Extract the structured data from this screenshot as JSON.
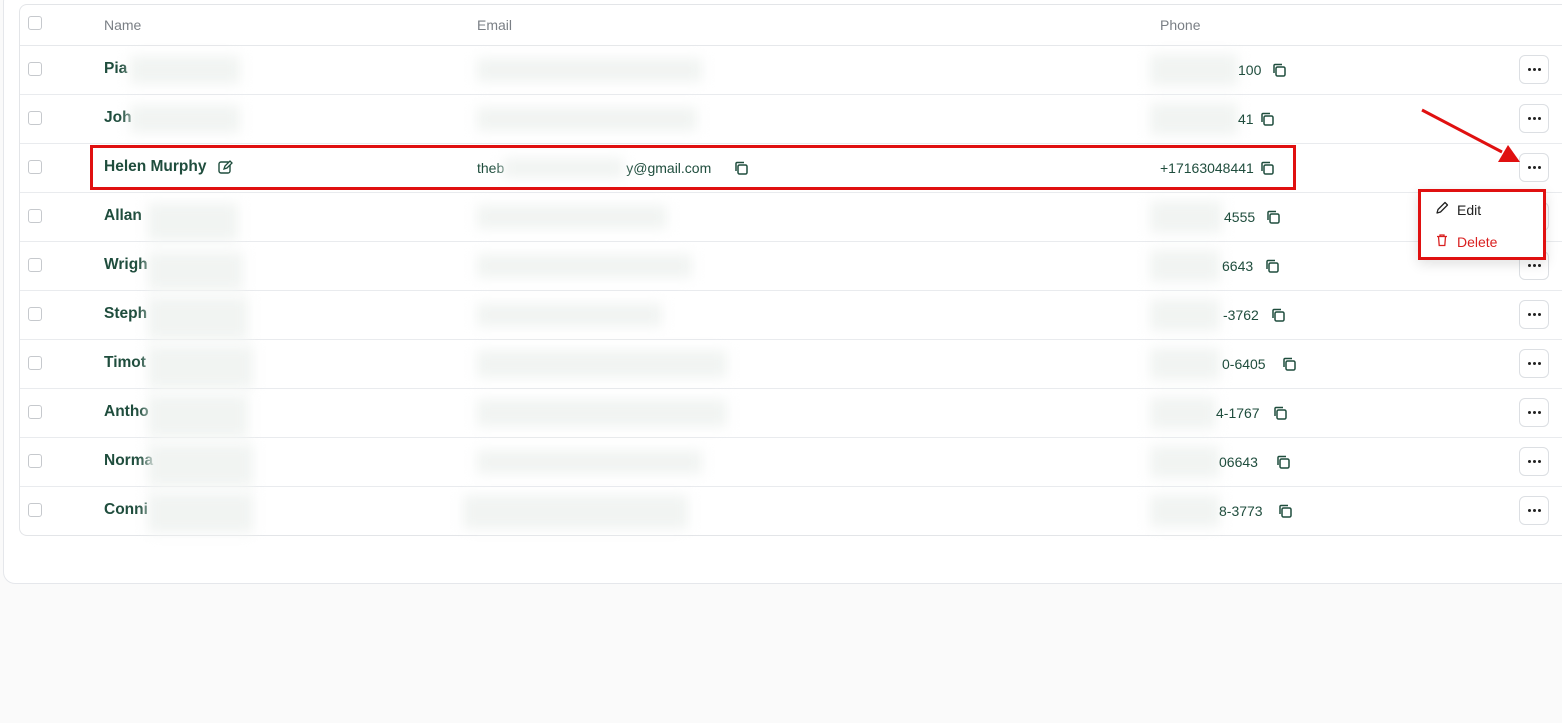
{
  "table": {
    "headers": {
      "name": "Name",
      "email": "Email",
      "phone": "Phone"
    },
    "rows": [
      {
        "name": "Pia",
        "email": "",
        "phone": "100"
      },
      {
        "name": "Joh",
        "email": "",
        "phone": "41"
      },
      {
        "name": "Helen Murphy",
        "email": "theb",
        "email_end": "y@gmail.com",
        "phone": "+17163048441"
      },
      {
        "name": "Allan",
        "email": "",
        "phone": "4555"
      },
      {
        "name": "Wrigh",
        "email": "",
        "phone": "6643"
      },
      {
        "name": "Steph",
        "email": "",
        "phone": "-3762"
      },
      {
        "name": "Timot",
        "email": "",
        "phone": "0-6405"
      },
      {
        "name": "Antho",
        "email": "",
        "phone": "4-1767"
      },
      {
        "name": "Norma",
        "email": "",
        "phone": "06643"
      },
      {
        "name": "Conni",
        "email": "",
        "phone": "8-3773"
      }
    ]
  },
  "menu": {
    "edit_label": "Edit",
    "delete_label": "Delete"
  },
  "colors": {
    "accent": "#1f4d3d",
    "annotation": "#e01010",
    "delete": "#d92020"
  }
}
